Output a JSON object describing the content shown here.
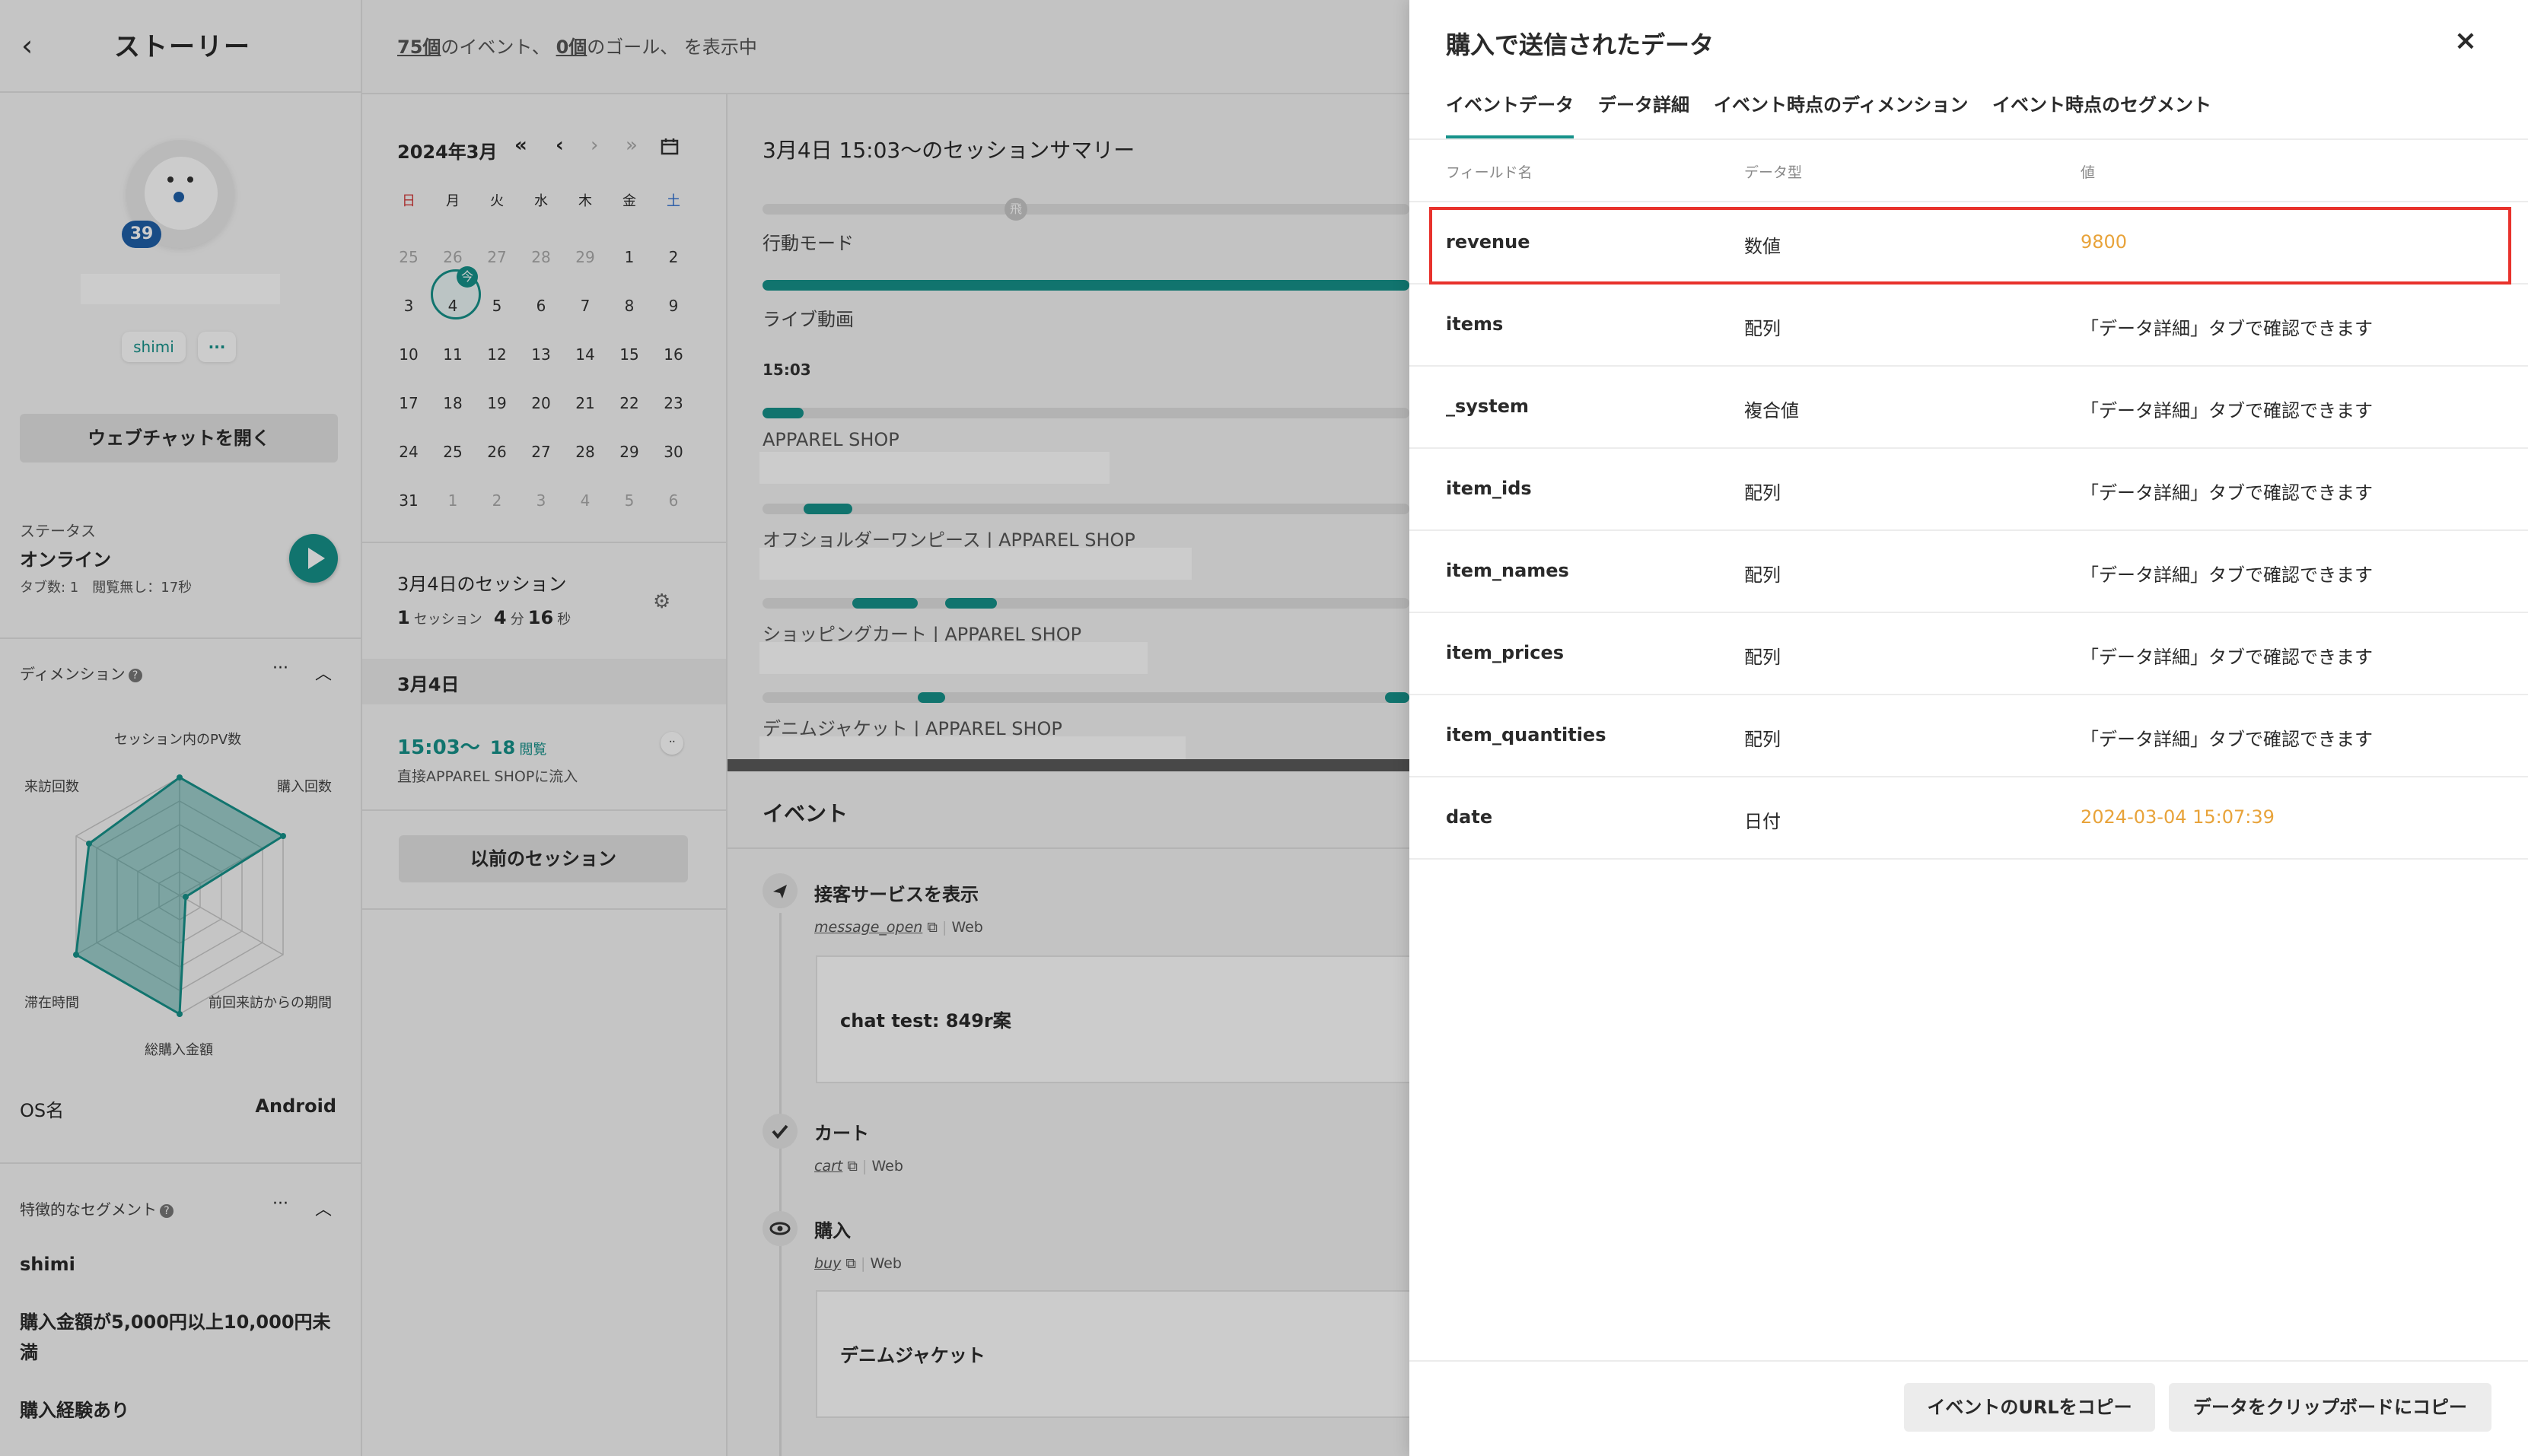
{
  "sidebar": {
    "title": "ストーリー",
    "badge_count": "39",
    "tag": "shimi",
    "more": "···",
    "webchat_button": "ウェブチャットを開く",
    "status_label": "ステータス",
    "status_value": "オンライン",
    "status_detail": "タブ数: 1　閲覧無し：17秒",
    "dimension_title": "ディメンション",
    "radar_labels": [
      "セッション内のPV数",
      "購入回数",
      "前回来訪からの期間",
      "総購入金額",
      "滞在時間",
      "来訪回数"
    ],
    "os_label": "OS名",
    "os_value": "Android",
    "segment_title": "特徴的なセグメント",
    "segments": [
      "shimi",
      "購入金額が5,000円以上10,000円未満",
      "購入経験あり"
    ]
  },
  "header": {
    "events_count": "75個",
    "events_text": "のイベント、",
    "goals_count": "0個",
    "goals_text": "のゴール、 を表示中"
  },
  "calendar": {
    "month": "2024年3月",
    "nav": [
      "«",
      "‹",
      "›",
      "»"
    ],
    "weekdays": [
      "日",
      "月",
      "火",
      "水",
      "木",
      "金",
      "土"
    ],
    "weeks": [
      [
        "25",
        "26",
        "27",
        "28",
        "29",
        "1",
        "2"
      ],
      [
        "3",
        "4",
        "5",
        "6",
        "7",
        "8",
        "9"
      ],
      [
        "10",
        "11",
        "12",
        "13",
        "14",
        "15",
        "16"
      ],
      [
        "17",
        "18",
        "19",
        "20",
        "21",
        "22",
        "23"
      ],
      [
        "24",
        "25",
        "26",
        "27",
        "28",
        "29",
        "30"
      ],
      [
        "31",
        "1",
        "2",
        "3",
        "4",
        "5",
        "6"
      ]
    ],
    "today_tag": "今",
    "today_number": "4",
    "sessions_title": "3月4日のセッション",
    "sessions_count": "1",
    "sessions_unit": "セッション",
    "minutes": "4",
    "minutes_unit": "分",
    "seconds": "16",
    "seconds_unit": "秒",
    "day_header": "3月4日",
    "session_time": "15:03〜",
    "session_views": "18",
    "session_views_unit": "閲覧",
    "session_source": "直接APPAREL SHOPに流入",
    "prev_button": "以前のセッション"
  },
  "summary": {
    "title": "3月4日 15:03〜のセッションサマリー",
    "mode_marker": "飛",
    "behavior_label": "行動モード",
    "live_label": "ライブ動画",
    "time_label": "15:03",
    "pages": [
      "APPAREL SHOP",
      "オフショルダーワンピース | APPAREL SHOP",
      "ショッピングカート | APPAREL SHOP",
      "デニムジャケット | APPAREL SHOP"
    ],
    "events_title": "イベント",
    "events": [
      {
        "title": "接客サービスを表示",
        "link": "message_open",
        "channel": "Web",
        "card": "chat test: 849r案"
      },
      {
        "title": "カート",
        "link": "cart",
        "channel": "Web"
      },
      {
        "title": "購入",
        "link": "buy",
        "channel": "Web",
        "card": "デニムジャケット"
      }
    ]
  },
  "panel": {
    "title": "購入で送信されたデータ",
    "close": "×",
    "tabs": [
      "イベントデータ",
      "データ詳細",
      "イベント時点のディメンション",
      "イベント時点のセグメント"
    ],
    "columns": [
      "フィールド名",
      "データ型",
      "値"
    ],
    "rows": [
      {
        "name": "revenue",
        "type": "数値",
        "value": "9800"
      },
      {
        "name": "items",
        "type": "配列",
        "value": "「データ詳細」タブで確認できます"
      },
      {
        "name": "_system",
        "type": "複合値",
        "value": "「データ詳細」タブで確認できます"
      },
      {
        "name": "item_ids",
        "type": "配列",
        "value": "「データ詳細」タブで確認できます"
      },
      {
        "name": "item_names",
        "type": "配列",
        "value": "「データ詳細」タブで確認できます"
      },
      {
        "name": "item_prices",
        "type": "配列",
        "value": "「データ詳細」タブで確認できます"
      },
      {
        "name": "item_quantities",
        "type": "配列",
        "value": "「データ詳細」タブで確認できます"
      },
      {
        "name": "date",
        "type": "日付",
        "value": "2024-03-04 15:07:39"
      }
    ],
    "copy_url_button": "イベントのURLをコピー",
    "copy_data_button": "データをクリップボードにコピー"
  },
  "colors": {
    "accent": "#16928a",
    "value_orange": "#e8a33a",
    "highlight_red": "#e8322c",
    "badge_blue": "#1e5fa8"
  }
}
